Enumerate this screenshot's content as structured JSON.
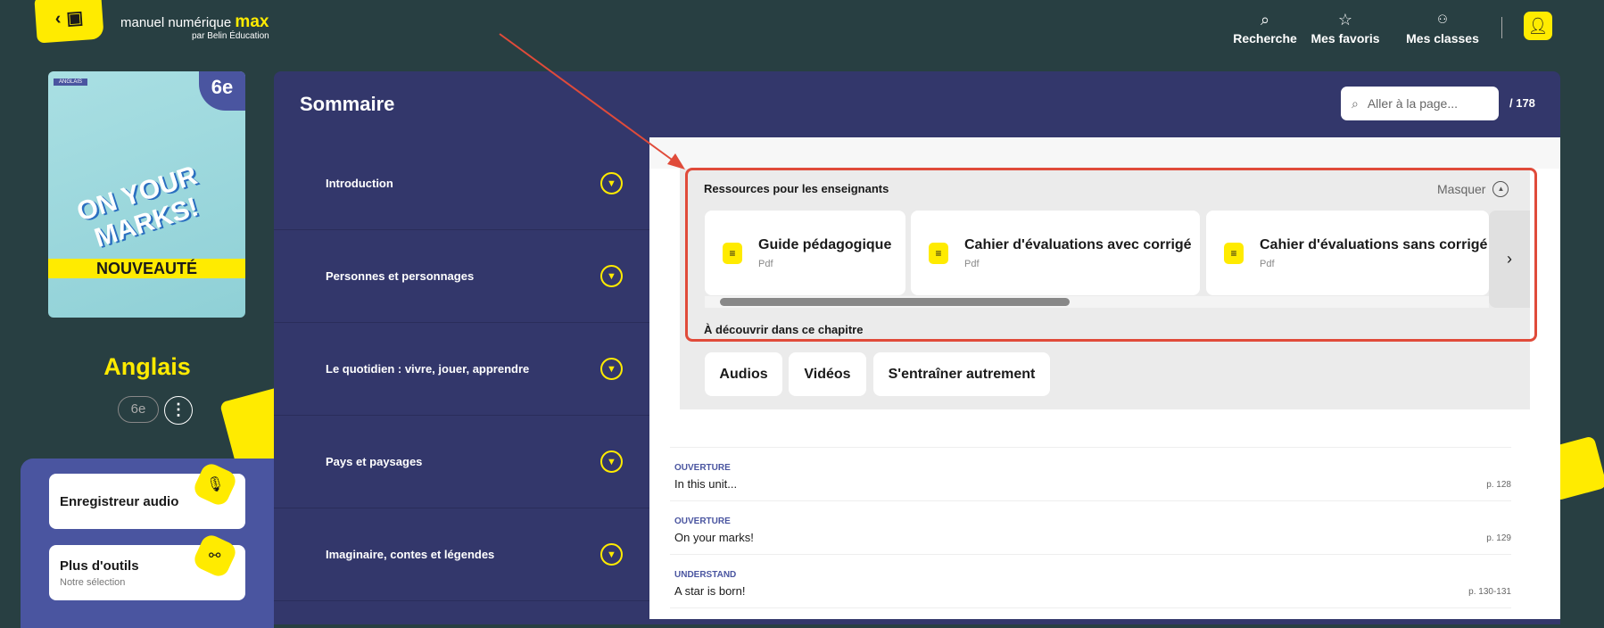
{
  "header": {
    "brand": "manuel numérique ",
    "brand_accent": "max",
    "brand_sub": "par Belin Éducation",
    "nav": [
      {
        "label": "Recherche",
        "icon": "search-icon"
      },
      {
        "label": "Mes favoris",
        "icon": "star-icon"
      },
      {
        "label": "Mes classes",
        "icon": "users-icon"
      }
    ]
  },
  "book": {
    "tag": "ANGLAIS",
    "grade": "6e",
    "cover_title": "ON YOUR MARKS!",
    "band": "NOUVEAUTÉ",
    "subject": "Anglais",
    "level": "6e"
  },
  "tools": [
    {
      "title": "Enregistreur audio",
      "subtitle": "",
      "icon": "microphone-icon"
    },
    {
      "title": "Plus d'outils",
      "subtitle": "Notre sélection",
      "icon": "share-nodes-icon"
    }
  ],
  "sommaire": {
    "title": "Sommaire",
    "search_placeholder": "Aller à la page...",
    "total_pages": "/ 178",
    "chapters": [
      "Introduction",
      "Personnes et personnages",
      "Le quotidien : vivre, jouer, apprendre",
      "Pays et paysages",
      "Imaginaire, contes et légendes"
    ]
  },
  "resources": {
    "title": "Ressources pour les enseignants",
    "toggle": "Masquer",
    "cards": [
      {
        "title": "Guide pédagogique",
        "type": "Pdf"
      },
      {
        "title": "Cahier d'évaluations avec corrigé",
        "type": "Pdf"
      },
      {
        "title": "Cahier d'évaluations sans corrigé",
        "type": "Pdf"
      }
    ],
    "discover_title": "À découvrir dans ce chapitre",
    "discover_buttons": [
      "Audios",
      "Vidéos",
      "S'entraîner autrement"
    ]
  },
  "items": [
    {
      "label": "OUVERTURE",
      "title": "In this unit...",
      "page": "p. 128"
    },
    {
      "label": "OUVERTURE",
      "title": "On your marks!",
      "page": "p. 129"
    },
    {
      "label": "UNDERSTAND",
      "title": "A star is born!",
      "page": "p. 130-131"
    }
  ],
  "colors": {
    "background": "#283f42",
    "panel": "#33376b",
    "accent": "#ffeb00",
    "annotation": "#e04b3a"
  }
}
